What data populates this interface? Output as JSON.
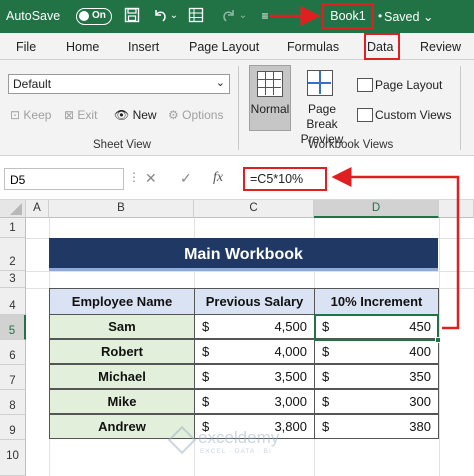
{
  "titlebar": {
    "autosave_label": "AutoSave",
    "autosave_state": "On",
    "book_name": "Book1",
    "saved_label": "Saved",
    "chevron": "⌄"
  },
  "menu": [
    "File",
    "Home",
    "Insert",
    "Page Layout",
    "Formulas",
    "Data",
    "Review"
  ],
  "ribbon": {
    "sheet_view": {
      "select_value": "Default",
      "keep": "Keep",
      "exit": "Exit",
      "new": "New",
      "options": "Options",
      "group_label": "Sheet View"
    },
    "workbook_views": {
      "normal": "Normal",
      "page_break_line1": "Page Break",
      "page_break_line2": "Preview",
      "page_layout": "Page Layout",
      "custom_views": "Custom Views",
      "group_label": "Workbook Views"
    }
  },
  "formula_bar": {
    "name_box": "D5",
    "cancel": "✕",
    "enter": "✓",
    "fx": "fx",
    "formula": "=C5*10%"
  },
  "sheet": {
    "columns": [
      "A",
      "B",
      "C",
      "D"
    ],
    "rows": [
      "1",
      "2",
      "3",
      "4",
      "5",
      "6",
      "7",
      "8",
      "9",
      "10"
    ],
    "title": "Main Workbook",
    "headers": [
      "Employee Name",
      "Previous Salary",
      "10% Increment"
    ],
    "currency": "$",
    "data": [
      {
        "name": "Sam",
        "salary": "4,500",
        "increment": "450"
      },
      {
        "name": "Robert",
        "salary": "4,000",
        "increment": "400"
      },
      {
        "name": "Michael",
        "salary": "3,500",
        "increment": "350"
      },
      {
        "name": "Mike",
        "salary": "3,000",
        "increment": "300"
      },
      {
        "name": "Andrew",
        "salary": "3,800",
        "increment": "380"
      }
    ]
  },
  "watermark": {
    "name": "exceldemy",
    "tagline": "EXCEL · DATA · BI"
  },
  "colors": {
    "excel_green": "#217346",
    "title_fill": "#203864",
    "header_fill": "#dae3f3",
    "name_fill": "#e2efda",
    "annotation_red": "#e02020"
  }
}
